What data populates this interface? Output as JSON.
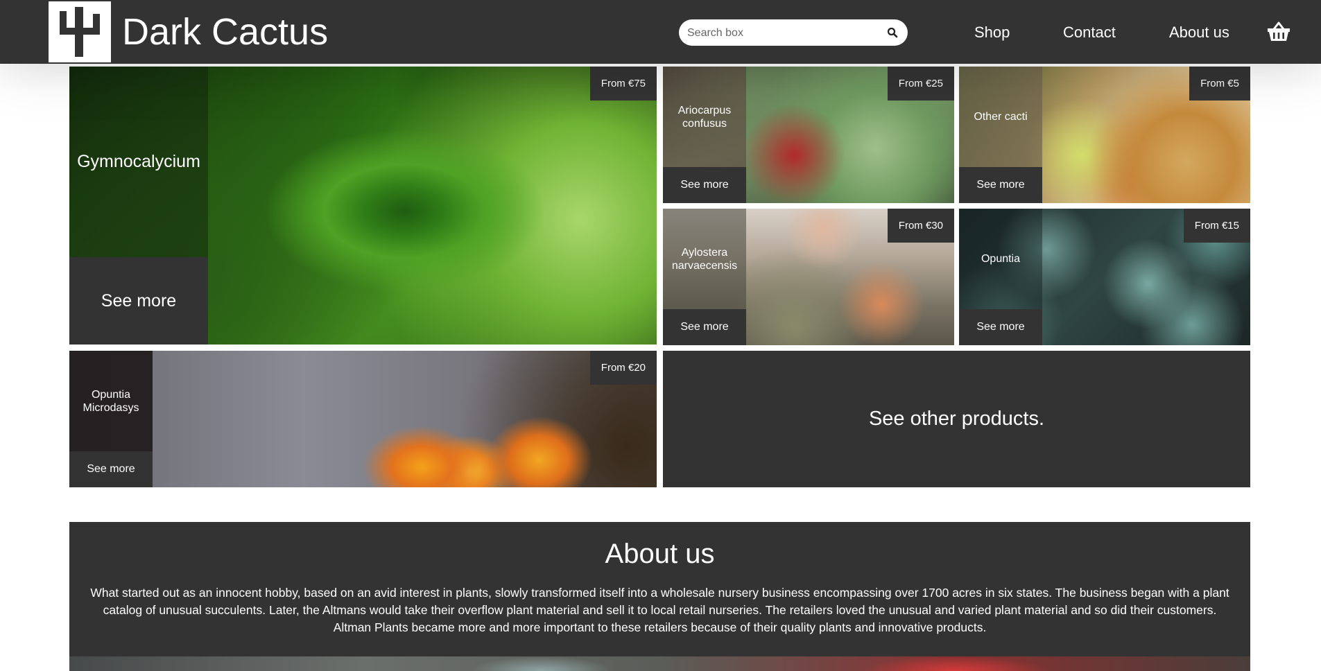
{
  "header": {
    "brand": "Dark Cactus",
    "search_placeholder": "Search box",
    "nav": [
      "Shop",
      "Contact",
      "About us"
    ],
    "icons": {
      "logo": "cactus-logo-icon",
      "search": "search-icon",
      "basket": "basket-icon"
    }
  },
  "products": [
    {
      "name": "Gymnocalycium",
      "price": "From €75",
      "more": "See more"
    },
    {
      "name": "Ariocarpus confusus",
      "price": "From €25",
      "more": "See more"
    },
    {
      "name": "Other cacti",
      "price": "From €5",
      "more": "See more"
    },
    {
      "name": "Aylostera narvaecensis",
      "price": "From €30",
      "more": "See more"
    },
    {
      "name": "Opuntia",
      "price": "From €15",
      "more": "See more"
    },
    {
      "name": "Opuntia Microdasys",
      "price": "From €20",
      "more": "See more"
    }
  ],
  "other_products": "See other products.",
  "about": {
    "title": "About us",
    "text": "What started out as an innocent hobby, based on an avid interest in plants, slowly transformed itself into a wholesale nursery business encompassing over 1700 acres in six states. The business began with a plant catalog of unusual succulents. Later, the Altmans would take their overflow plant material and sell it to local retail nurseries. The retailers loved the unusual and varied plant material and so did their customers. Altman Plants became more and more important to these retailers because of their quality plants and innovative products."
  },
  "colors": {
    "dark": "#333333",
    "background": "#ffffff",
    "text": "#ffffff"
  }
}
